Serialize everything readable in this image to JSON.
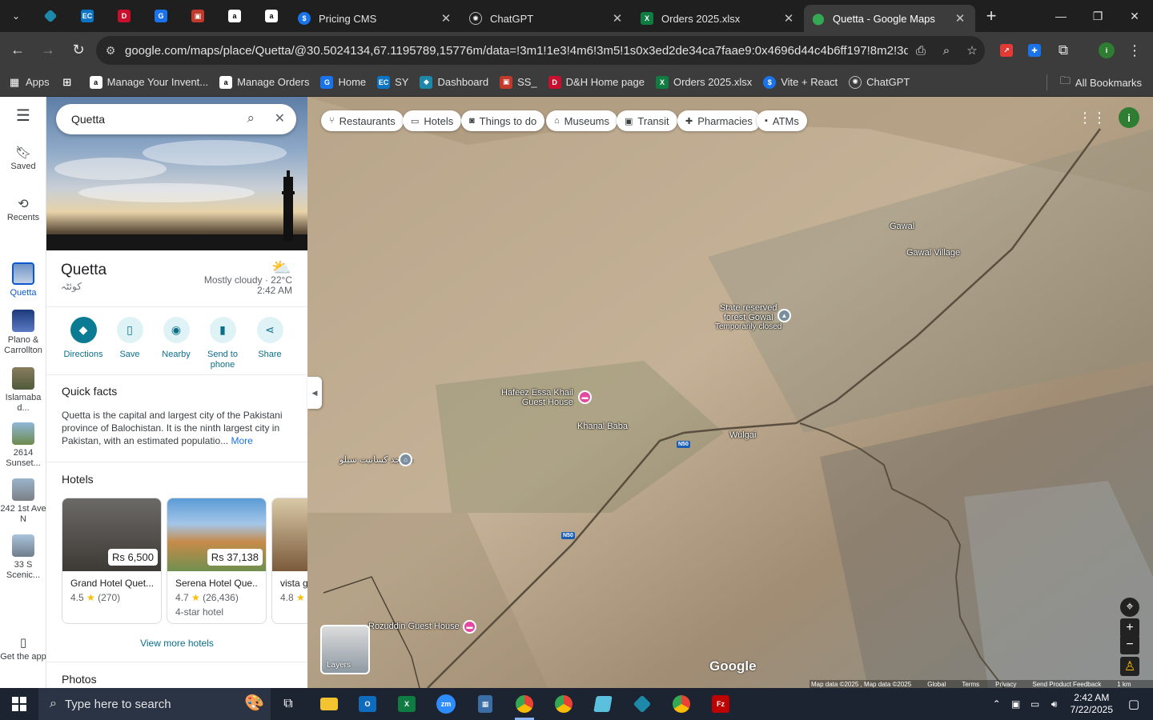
{
  "browser": {
    "tabs": [
      {
        "title": "Pricing CMS",
        "active": false
      },
      {
        "title": "ChatGPT",
        "active": false
      },
      {
        "title": "Orders 2025.xlsx",
        "active": false
      },
      {
        "title": "Quetta - Google Maps",
        "active": true
      }
    ],
    "url": "google.com/maps/place/Quetta/@30.5024134,67.1195789,15776m/data=!3m1!1e3!4m6!3m5!1s0x3ed2de34ca7faae9:0x4696d44c4b6ff197!8m2!3d30.183...",
    "bookmarks": [
      "Apps",
      "Manage Your Invent...",
      "Manage Orders",
      "Home",
      "SY",
      "Dashboard",
      "SS_",
      "D&H Home page",
      "Orders 2025.xlsx",
      "Vite + React",
      "ChatGPT"
    ],
    "all_bookmarks": "All Bookmarks"
  },
  "rail": {
    "items": [
      {
        "label": "Saved"
      },
      {
        "label": "Recents"
      },
      {
        "label": "Quetta"
      },
      {
        "label": "Plano & Carrollton"
      },
      {
        "label": "Islamaba d..."
      },
      {
        "label": "2614 Sunset..."
      },
      {
        "label": "242 1st Ave N"
      },
      {
        "label": "33 S Scenic..."
      },
      {
        "label": "Get the app"
      }
    ]
  },
  "panel": {
    "search_value": "Quetta",
    "place_name": "Quetta",
    "place_native": "کوئٹہ",
    "weather": {
      "condition": "Mostly cloudy · 22°C",
      "time": "2:42 AM"
    },
    "actions": [
      {
        "label": "Directions"
      },
      {
        "label": "Save"
      },
      {
        "label": "Nearby"
      },
      {
        "label": "Send to phone"
      },
      {
        "label": "Share"
      }
    ],
    "quick_facts_title": "Quick facts",
    "quick_facts_text": "Quetta is the capital and largest city of the Pakistani province of Balochistan. It is the ninth largest city in Pakistan, with an estimated populatio...",
    "more_label": "More",
    "hotels_title": "Hotels",
    "hotels": [
      {
        "name": "Grand Hotel Quet...",
        "price": "Rs 6,500",
        "rating": "4.5",
        "reviews": "(270)",
        "kind": ""
      },
      {
        "name": "Serena Hotel Que...",
        "price": "Rs 37,138",
        "rating": "4.7",
        "reviews": "(26,436)",
        "kind": "4-star hotel"
      },
      {
        "name": "vista g",
        "price": "",
        "rating": "4.8",
        "reviews": "",
        "kind": ""
      }
    ],
    "view_more_hotels": "View more hotels",
    "photos_title": "Photos"
  },
  "map": {
    "chips": [
      {
        "label": "Restaurants",
        "icon": "fork-knife-icon"
      },
      {
        "label": "Hotels",
        "icon": "bed-icon"
      },
      {
        "label": "Things to do",
        "icon": "camera-icon"
      },
      {
        "label": "Museums",
        "icon": "museum-icon"
      },
      {
        "label": "Transit",
        "icon": "bus-icon"
      },
      {
        "label": "Pharmacies",
        "icon": "pharmacy-icon"
      },
      {
        "label": "ATMs",
        "icon": "atm-icon"
      }
    ],
    "labels": {
      "gawal": "Gawal",
      "gawal_village": "Gawal Village",
      "state_forest_1": "State reserved",
      "state_forest_2": "forest Gowal",
      "state_forest_3": "Temporarily closed",
      "hafeez_1": "Hafeez Essa Khail",
      "hafeez_2": "Guest House",
      "khanal_baba": "Khanal Baba",
      "wulgai": "Wulgai",
      "masjid": "مسجد کسانیت سیلو",
      "rozuddin": "Rozuddin Guest House",
      "n50_a": "N50",
      "n50_b": "N50"
    },
    "layers_label": "Layers",
    "google_logo": "Google",
    "attribution": [
      "Map data ©2025 , Map data ©2025",
      "Global",
      "Terms",
      "Privacy",
      "Send Product Feedback",
      "1 km"
    ]
  },
  "taskbar": {
    "search_placeholder": "Type here to search",
    "time": "2:42 AM",
    "date": "7/22/2025"
  }
}
